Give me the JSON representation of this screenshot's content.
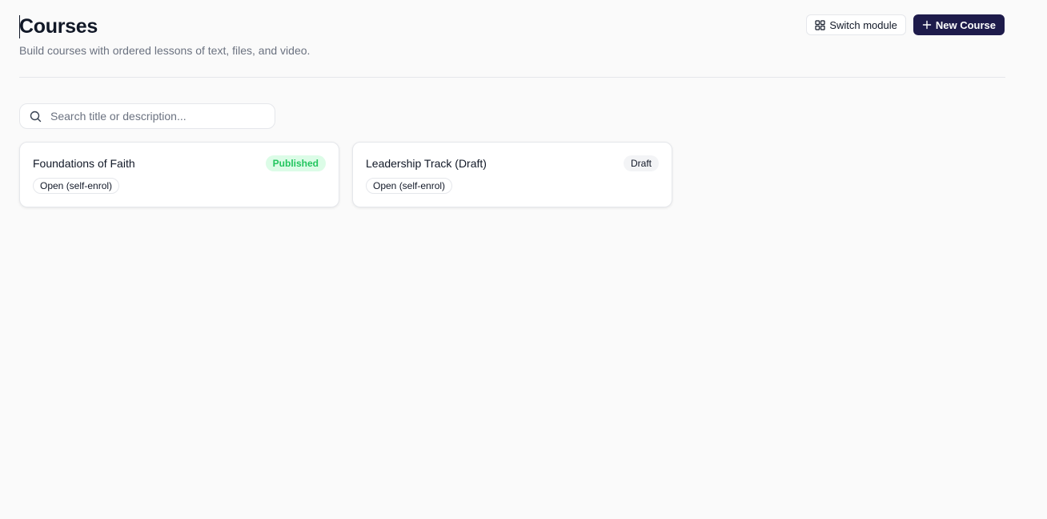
{
  "header": {
    "title": "Courses",
    "subtitle": "Build courses with ordered lessons of text, files, and video."
  },
  "actions": {
    "switch_module": {
      "label": "Switch module",
      "icon": "grid-icon"
    },
    "new_course": {
      "label": "New Course",
      "icon": "plus-icon"
    }
  },
  "search": {
    "placeholder": "Search title or description...",
    "value": "",
    "icon": "search-icon"
  },
  "courses": [
    {
      "title": "Foundations of Faith",
      "status": "Published",
      "enrolment": "Open (self-enrol)"
    },
    {
      "title": "Leadership Track (Draft)",
      "status": "Draft",
      "enrolment": "Open (self-enrol)"
    }
  ],
  "colors": {
    "primary": "#1e1b4b",
    "published_text": "#22c55e",
    "published_bg": "#dcfce7",
    "draft_bg": "#f3f4f6",
    "border": "#e5e7eb",
    "muted_text": "#6b7280",
    "background": "#fafafa"
  }
}
